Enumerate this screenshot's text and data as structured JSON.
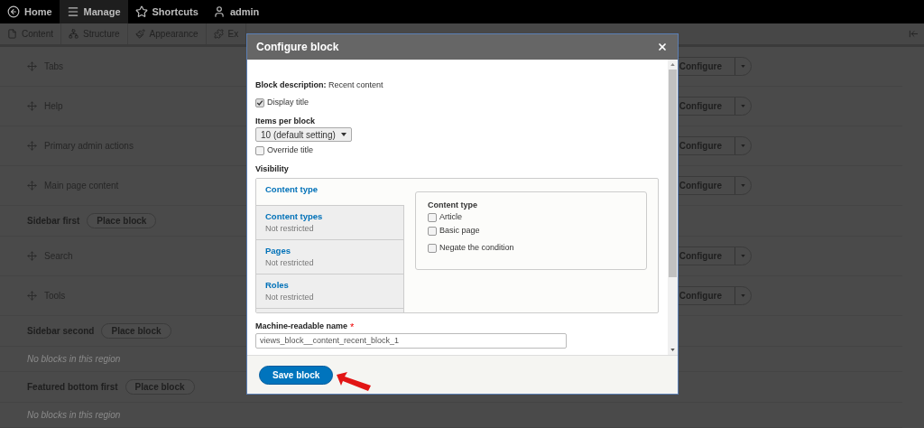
{
  "toolbar": {
    "items": [
      {
        "label": "Home",
        "selected": false
      },
      {
        "label": "Manage",
        "selected": true
      },
      {
        "label": "Shortcuts",
        "selected": false
      },
      {
        "label": "admin",
        "selected": false
      }
    ]
  },
  "tray": {
    "items": [
      {
        "label": "Content"
      },
      {
        "label": "Structure"
      },
      {
        "label": "Appearance"
      },
      {
        "label": "Ex"
      }
    ]
  },
  "rows": [
    {
      "kind": "block",
      "label": "Tabs",
      "button": "Configure"
    },
    {
      "kind": "block",
      "label": "Help",
      "button": "Configure"
    },
    {
      "kind": "block",
      "label": "Primary admin actions",
      "button": "Configure"
    },
    {
      "kind": "block",
      "label": "Main page content",
      "button": "Configure"
    },
    {
      "kind": "region",
      "label": "Sidebar first",
      "button": "Place block"
    },
    {
      "kind": "block",
      "label": "Search",
      "button": "Configure"
    },
    {
      "kind": "block",
      "label": "Tools",
      "button": "Configure"
    },
    {
      "kind": "region",
      "label": "Sidebar second",
      "button": "Place block"
    },
    {
      "kind": "empty",
      "label": "No blocks in this region"
    },
    {
      "kind": "region",
      "label": "Featured bottom first",
      "button": "Place block"
    },
    {
      "kind": "empty",
      "label": "No blocks in this region"
    }
  ],
  "modal": {
    "title": "Configure block",
    "block_description": {
      "label": "Block description:",
      "value": "Recent content"
    },
    "display_title": {
      "label": "Display title",
      "checked": true
    },
    "items_per_block": {
      "label": "Items per block",
      "value": "10 (default setting)"
    },
    "override_title": {
      "label": "Override title",
      "checked": false
    },
    "visibility": {
      "title": "Visibility",
      "tabs": [
        {
          "label": "Content type",
          "selected": true
        },
        {
          "label": "Content types",
          "summary": "Not restricted",
          "selected": false
        },
        {
          "label": "Pages",
          "summary": "Not restricted",
          "selected": false
        },
        {
          "label": "Roles",
          "summary": "Not restricted",
          "selected": false
        }
      ],
      "pane": {
        "title": "Content type",
        "options": [
          {
            "label": "Article",
            "checked": false
          },
          {
            "label": "Basic page",
            "checked": false
          }
        ],
        "negate": {
          "label": "Negate the condition",
          "checked": false
        }
      }
    },
    "machine_name": {
      "label": "Machine-readable name",
      "required_mark": "*",
      "value": "views_block__content_recent_block_1"
    },
    "save_button": "Save block"
  }
}
